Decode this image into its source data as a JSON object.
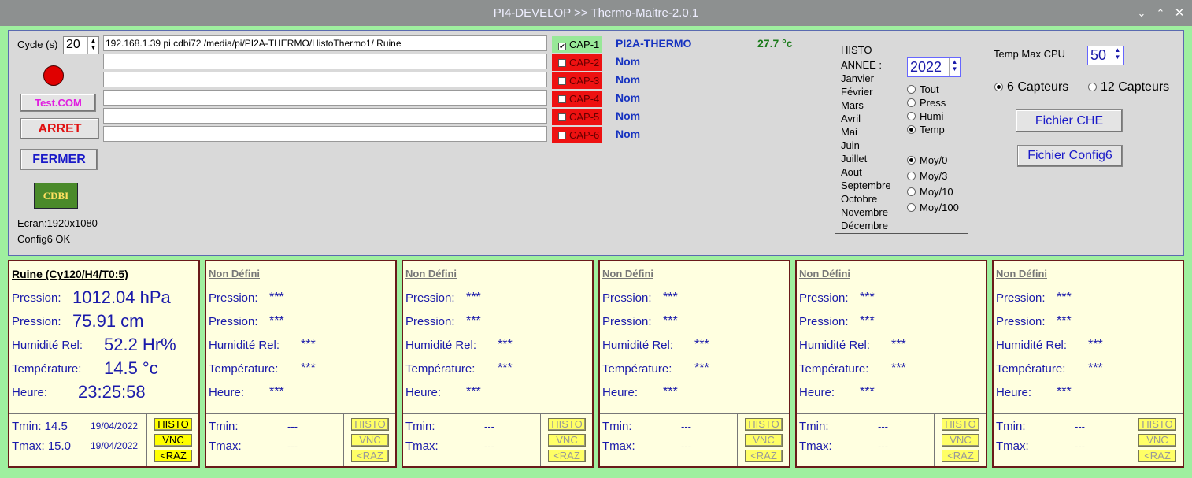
{
  "window": {
    "title": "PI4-DEVELOP >> Thermo-Maitre-2.0.1",
    "min_icon": "chevron-down-icon",
    "max_icon": "chevron-up-icon",
    "close_icon": "close-icon"
  },
  "left": {
    "cycle_label": "Cycle (s)",
    "cycle_value": "20",
    "status_color": "#e00000",
    "test_button": "Test.COM",
    "arret_button": "ARRET",
    "fermer_button": "FERMER",
    "logo_text": "CDBI",
    "ecran": "Ecran:1920x1080",
    "config": "Config6 OK"
  },
  "sensors": [
    {
      "path": "192.168.1.39 pi cdbi72 /media/pi/PI2A-THERMO/HistoThermo1/ Ruine",
      "cap": "CAP-1",
      "checked": true,
      "name": "PI2A-THERMO",
      "temp": "27.7 °c"
    },
    {
      "path": "",
      "cap": "CAP-2",
      "checked": false,
      "name": "Nom",
      "temp": ""
    },
    {
      "path": "",
      "cap": "CAP-3",
      "checked": false,
      "name": "Nom",
      "temp": ""
    },
    {
      "path": "",
      "cap": "CAP-4",
      "checked": false,
      "name": "Nom",
      "temp": ""
    },
    {
      "path": "",
      "cap": "CAP-5",
      "checked": false,
      "name": "Nom",
      "temp": ""
    },
    {
      "path": "",
      "cap": "CAP-6",
      "checked": false,
      "name": "Nom",
      "temp": ""
    }
  ],
  "histo": {
    "legend": "HISTO",
    "annee_label": "ANNEE :",
    "annee_value": "2022",
    "months": [
      "Janvier",
      "Février",
      "Mars",
      "Avril",
      "Mai",
      "Juin",
      "Juillet",
      "Aout",
      "Septembre",
      "Octobre",
      "Novembre",
      "Décembre"
    ],
    "types": [
      {
        "label": "Tout",
        "selected": false
      },
      {
        "label": "Press",
        "selected": false
      },
      {
        "label": "Humi",
        "selected": false
      },
      {
        "label": "Temp",
        "selected": true
      }
    ],
    "moy": [
      {
        "label": "Moy/0",
        "selected": true
      },
      {
        "label": "Moy/3",
        "selected": false
      },
      {
        "label": "Moy/10",
        "selected": false
      },
      {
        "label": "Moy/100",
        "selected": false
      }
    ]
  },
  "right": {
    "temp_max_label": "Temp Max CPU",
    "temp_max_value": "50",
    "capteurs_6": "6 Capteurs",
    "capteurs_12": "12 Capteurs",
    "fichier_che": "Fichier CHE",
    "fichier_config": "Fichier Config6"
  },
  "cards": [
    {
      "title": "Ruine  (Cy120/H4/T0:5)",
      "pression_label": "Pression:",
      "pression": "1012.04 hPa",
      "pression2": "75.91 cm",
      "humidite_label": "Humidité Rel:",
      "humidite": "52.2 Hr%",
      "temperature_label": "Température:",
      "temperature": "14.5 °c",
      "heure_label": "Heure:",
      "heure": "23:25:58",
      "tmin_label": "Tmin: 14.5",
      "tmin_date": "19/04/2022",
      "tmax_label": "Tmax: 15.0",
      "tmax_date": "19/04/2022",
      "histo_btn": "HISTO",
      "vnc_btn": "VNC",
      "raz_btn": "<RAZ"
    },
    {
      "title": "Non Défini",
      "pression_label": "Pression:",
      "pression": "***",
      "pression2": "***",
      "humidite_label": "Humidité Rel:",
      "humidite": "***",
      "temperature_label": "Température:",
      "temperature": "***",
      "heure_label": "Heure:",
      "heure": "***",
      "tmin_label": "Tmin:",
      "tmin_val": "---",
      "tmax_label": "Tmax:",
      "tmax_val": "---",
      "histo_btn": "HISTO",
      "vnc_btn": "VNC",
      "raz_btn": "<RAZ"
    },
    {
      "title": "Non Défini",
      "pression_label": "Pression:",
      "pression": "***",
      "pression2": "***",
      "humidite_label": "Humidité Rel:",
      "humidite": "***",
      "temperature_label": "Température:",
      "temperature": "***",
      "heure_label": "Heure:",
      "heure": "***",
      "tmin_label": "Tmin:",
      "tmin_val": "---",
      "tmax_label": "Tmax:",
      "tmax_val": "---",
      "histo_btn": "HISTO",
      "vnc_btn": "VNC",
      "raz_btn": "<RAZ"
    },
    {
      "title": "Non Défini",
      "pression_label": "Pression:",
      "pression": "***",
      "pression2": "***",
      "humidite_label": "Humidité Rel:",
      "humidite": "***",
      "temperature_label": "Température:",
      "temperature": "***",
      "heure_label": "Heure:",
      "heure": "***",
      "tmin_label": "Tmin:",
      "tmin_val": "---",
      "tmax_label": "Tmax:",
      "tmax_val": "---",
      "histo_btn": "HISTO",
      "vnc_btn": "VNC",
      "raz_btn": "<RAZ"
    },
    {
      "title": "Non Défini",
      "pression_label": "Pression:",
      "pression": "***",
      "pression2": "***",
      "humidite_label": "Humidité Rel:",
      "humidite": "***",
      "temperature_label": "Température:",
      "temperature": "***",
      "heure_label": "Heure:",
      "heure": "***",
      "tmin_label": "Tmin:",
      "tmin_val": "---",
      "tmax_label": "Tmax:",
      "tmax_val": "---",
      "histo_btn": "HISTO",
      "vnc_btn": "VNC",
      "raz_btn": "<RAZ"
    },
    {
      "title": "Non Défini",
      "pression_label": "Pression:",
      "pression": "***",
      "pression2": "***",
      "humidite_label": "Humidité Rel:",
      "humidite": "***",
      "temperature_label": "Température:",
      "temperature": "***",
      "heure_label": "Heure:",
      "heure": "***",
      "tmin_label": "Tmin:",
      "tmin_val": "---",
      "tmax_label": "Tmax:",
      "tmax_val": "---",
      "histo_btn": "HISTO",
      "vnc_btn": "VNC",
      "raz_btn": "<RAZ"
    }
  ]
}
